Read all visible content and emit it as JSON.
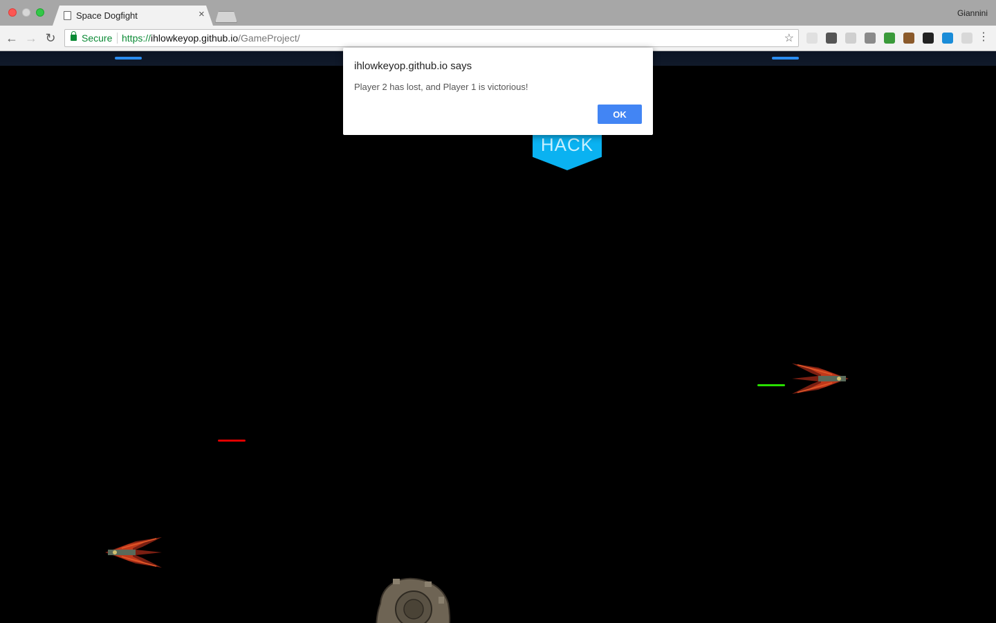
{
  "browser": {
    "tab_title": "Space Dogfight",
    "tab_close_glyph": "×",
    "profile_name": "Giannini",
    "security_label": "Secure",
    "url_scheme": "https://",
    "url_host": "ihlowkeyop.github.io",
    "url_path": "/GameProject/",
    "icons": [
      "back-arrow-icon",
      "forward-arrow-icon",
      "reload-icon",
      "lock-icon",
      "star-icon",
      "menu-icon"
    ],
    "extension_colors": [
      "#e0e0e0",
      "#555555",
      "#cfcfcf",
      "#8a8a8a",
      "#3a9a3a",
      "#8b5a2b",
      "#222222",
      "#1a8cd8",
      "#d8d8d8"
    ]
  },
  "game": {
    "hack_badge_label": "HACK",
    "health_bar_colors": {
      "player_top_left": "#2a8cf0",
      "player_top_right": "#2a8cf0",
      "enemy_red": "#e00000",
      "enemy_green": "#28e000"
    }
  },
  "dialog": {
    "title": "ihlowkeyop.github.io says",
    "message": "Player 2 has lost, and Player 1 is victorious!",
    "ok_label": "OK",
    "ok_color": "#4285f4"
  }
}
